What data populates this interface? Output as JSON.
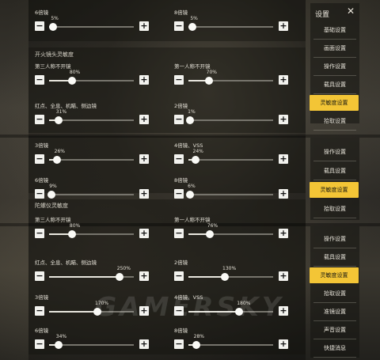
{
  "header": {
    "title": "设置",
    "close_icon": "close-icon"
  },
  "menu_panel_1": [
    {
      "label": "基础设置",
      "active": false
    },
    {
      "label": "画面设置",
      "active": false
    },
    {
      "label": "操作设置",
      "active": false
    },
    {
      "label": "载具设置",
      "active": false
    },
    {
      "label": "灵敏度设置",
      "active": true
    },
    {
      "label": "拾取设置",
      "active": false
    }
  ],
  "menu_panel_2": [
    {
      "label": "操作设置",
      "active": false
    },
    {
      "label": "载具设置",
      "active": false
    },
    {
      "label": "灵敏度设置",
      "active": true
    },
    {
      "label": "拾取设置",
      "active": false
    }
  ],
  "menu_panel_3": [
    {
      "label": "操作设置",
      "active": false
    },
    {
      "label": "载具设置",
      "active": false
    },
    {
      "label": "灵敏度设置",
      "active": true
    },
    {
      "label": "拾取设置",
      "active": false
    },
    {
      "label": "准镜设置",
      "active": false
    },
    {
      "label": "声音设置",
      "active": false
    },
    {
      "label": "快捷消息",
      "active": false
    }
  ],
  "section_fire": {
    "title": "开火镜头灵敏度"
  },
  "section_gyro": {
    "title": "陀螺仪灵敏度"
  },
  "sliders": {
    "s1": {
      "label": "6倍镜",
      "value": "5%"
    },
    "s2": {
      "label": "8倍镜",
      "value": "5%"
    },
    "s3": {
      "label": "第三人称不开镜",
      "value": "80%"
    },
    "s4": {
      "label": "第一人称不开镜",
      "value": "70%"
    },
    "s5": {
      "label": "红点、全息、机瞄、侧边镜",
      "value": "31%"
    },
    "s6": {
      "label": "2倍镜",
      "value": "1%"
    },
    "s7": {
      "label": "3倍镜",
      "value": "26%"
    },
    "s8": {
      "label": "4倍镜、VSS",
      "value": "24%"
    },
    "s9": {
      "label": "6倍镜",
      "value": "9%"
    },
    "s10": {
      "label": "8倍镜",
      "value": "6%"
    },
    "s11": {
      "label": "第三人称不开镜",
      "value": "80%"
    },
    "s12": {
      "label": "第一人称不开镜",
      "value": "76%"
    },
    "s13": {
      "label": "红点、全息、机瞄、侧边镜",
      "value": "250%"
    },
    "s14": {
      "label": "2倍镜",
      "value": "130%"
    },
    "s15": {
      "label": "3倍镜",
      "value": "170%"
    },
    "s16": {
      "label": "4倍镜、VSS",
      "value": "180%"
    },
    "s17": {
      "label": "6倍镜",
      "value": "34%"
    },
    "s18": {
      "label": "8倍镜",
      "value": "28%"
    }
  },
  "slider_levels": {
    "s1": 0.05,
    "s2": 0.05,
    "s3": 0.27,
    "s4": 0.24,
    "s5": 0.11,
    "s6": 0.02,
    "s7": 0.09,
    "s8": 0.08,
    "s9": 0.03,
    "s10": 0.02,
    "s11": 0.27,
    "s12": 0.25,
    "s13": 0.83,
    "s14": 0.43,
    "s15": 0.57,
    "s16": 0.6,
    "s17": 0.11,
    "s18": 0.09
  },
  "buttons": {
    "minus": "−",
    "plus": "+"
  },
  "watermark": "GAMERSKY"
}
